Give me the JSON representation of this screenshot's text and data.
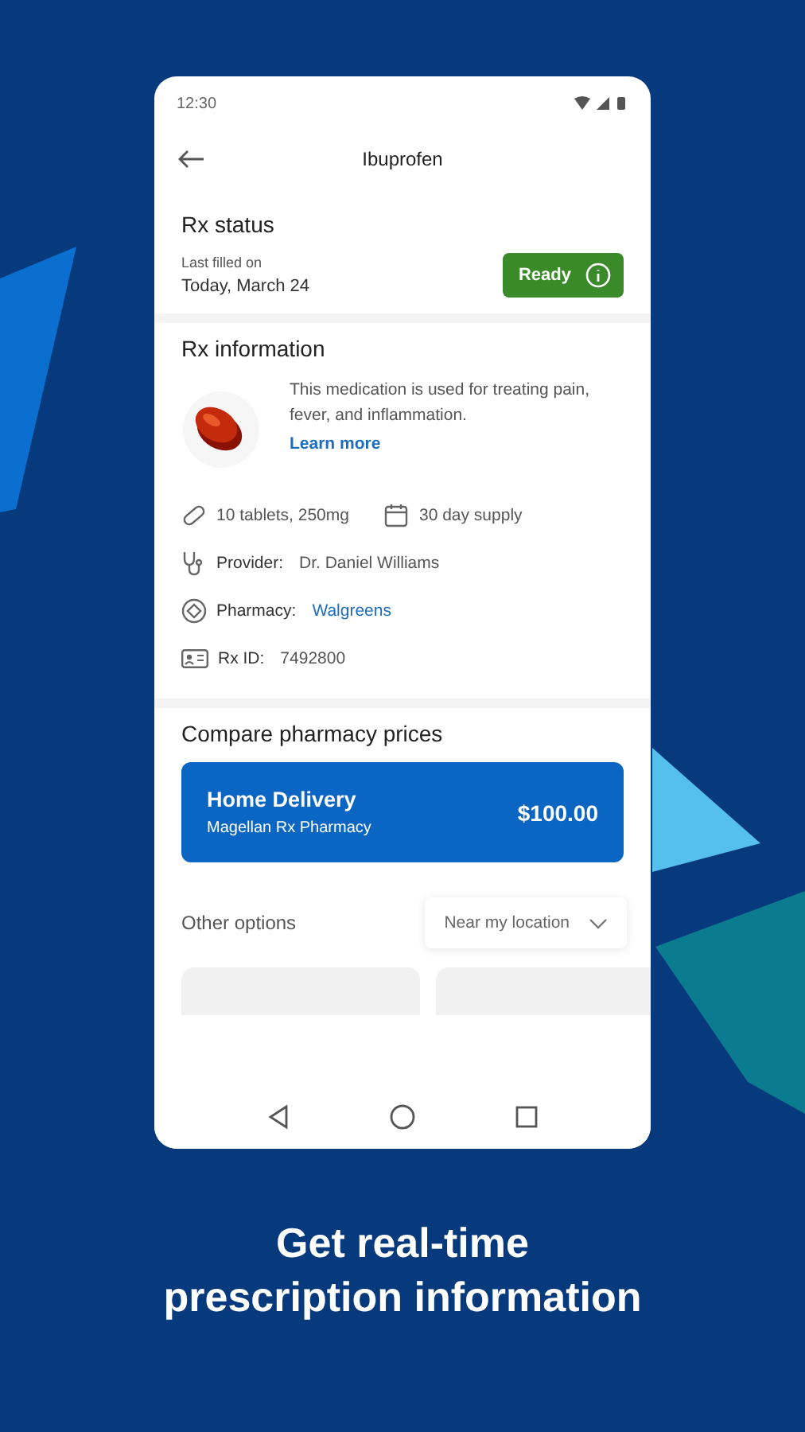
{
  "status_bar": {
    "time": "12:30"
  },
  "header": {
    "title": "Ibuprofen"
  },
  "rx_status": {
    "heading": "Rx status",
    "label": "Last filled on",
    "date": "Today, March 24",
    "badge": {
      "label": "Ready",
      "kind": "success"
    }
  },
  "rx_information": {
    "heading": "Rx information",
    "description": "This medication is used for treating pain, fever, and inflammation.",
    "link": "Learn more",
    "details": [
      [
        {
          "kind": "dosage",
          "value": "10 tablets, 250mg"
        },
        {
          "kind": "supply",
          "value": "30 day supply"
        }
      ],
      [
        {
          "kind": "provider",
          "label": "Provider:",
          "value": "Dr. Daniel Williams"
        }
      ],
      [
        {
          "kind": "pharmacy",
          "label": "Pharmacy:",
          "value": "Walgreens"
        }
      ],
      [
        {
          "kind": "rx_id",
          "label": "Rx ID:",
          "value": "7492800"
        }
      ]
    ]
  },
  "compare": {
    "heading": "Compare pharmacy prices",
    "featured": {
      "title": "Home Delivery",
      "subtitle": "Magellan Rx Pharmacy",
      "price": "$100.00"
    },
    "other_label": "Other options",
    "filter": "Near my location"
  },
  "caption": [
    "Get real-time",
    "prescription information"
  ]
}
